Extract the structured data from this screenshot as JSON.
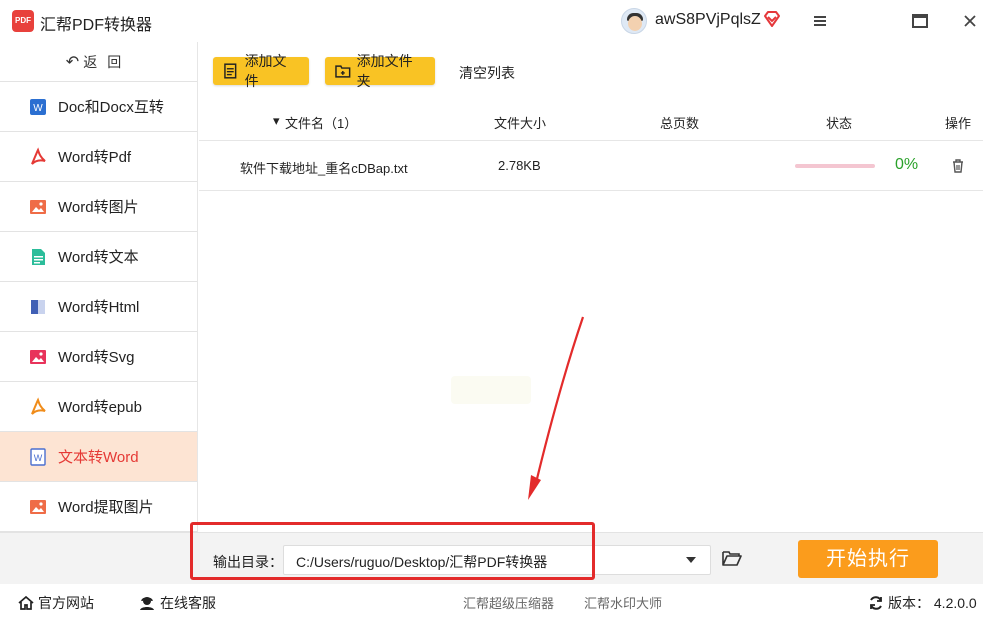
{
  "app": {
    "title": "汇帮PDF转换器",
    "logo_text": "PDF",
    "username": "awS8PVjPqlsZ"
  },
  "sidebar": {
    "back_label": "返回",
    "items": [
      {
        "label": "Doc和Docx互转",
        "icon": "word-doc-icon",
        "color": "#2b6fd1"
      },
      {
        "label": "Word转Pdf",
        "icon": "pdf-icon",
        "color": "#e53935"
      },
      {
        "label": "Word转图片",
        "icon": "image-icon",
        "color": "#ef6c47"
      },
      {
        "label": "Word转文本",
        "icon": "text-file-icon",
        "color": "#2bbd9a"
      },
      {
        "label": "Word转Html",
        "icon": "html-icon",
        "color": "#3f5fb5"
      },
      {
        "label": "Word转Svg",
        "icon": "svg-icon",
        "color": "#e8335b"
      },
      {
        "label": "Word转epub",
        "icon": "epub-icon",
        "color": "#f08c1a"
      },
      {
        "label": "文本转Word",
        "icon": "text-to-word-icon",
        "color": "#4a6fd0",
        "active": true
      },
      {
        "label": "Word提取图片",
        "icon": "extract-image-icon",
        "color": "#ef6c47"
      }
    ]
  },
  "toolbar": {
    "add_file": "添加文件",
    "add_folder": "添加文件夹",
    "clear_list": "清空列表"
  },
  "table": {
    "headers": {
      "name": "文件名（1）",
      "size": "文件大小",
      "pages": "总页数",
      "status": "状态",
      "action": "操作"
    },
    "rows": [
      {
        "name": "软件下载地址_重名cDBap.txt",
        "size": "2.78KB",
        "pages": "",
        "progress": 0,
        "progress_text": "0%"
      }
    ]
  },
  "output": {
    "label": "输出目录：",
    "path": "C:/Users/ruguo/Desktop/汇帮PDF转换器",
    "start_label": "开始执行"
  },
  "footer": {
    "website": "官方网站",
    "support": "在线客服",
    "compressor": "汇帮超级压缩器",
    "watermark": "汇帮水印大师",
    "version": "版本：  4.2.0.0"
  },
  "colors": {
    "accent_yellow": "#f9c324",
    "start_orange": "#fb9c1c",
    "active_bg": "#fde4d3",
    "active_text": "#e53935",
    "progress_green": "#2aa12a"
  }
}
